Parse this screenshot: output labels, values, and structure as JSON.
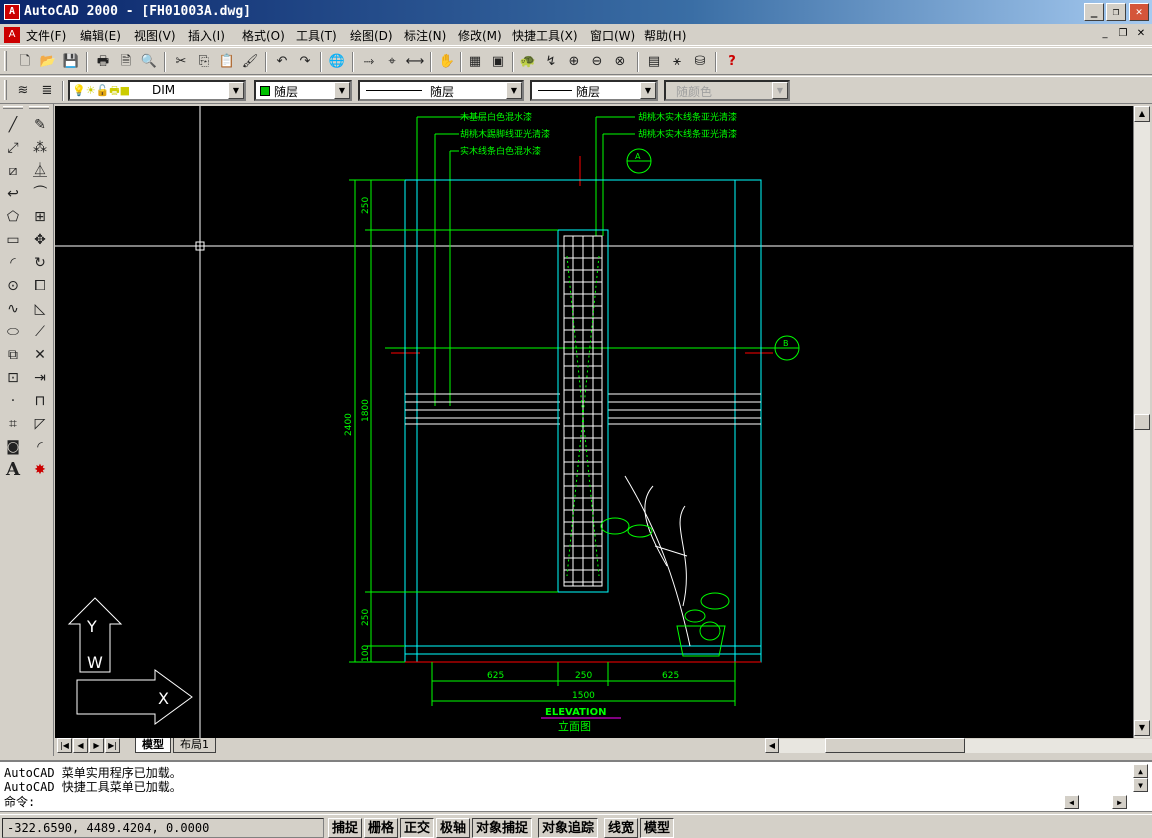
{
  "window": {
    "app_icon": "autocad-logo-icon",
    "title": "AutoCAD 2000 - [FH01003A.dwg]",
    "buttons": [
      "_",
      "❐",
      "✕"
    ]
  },
  "menu": {
    "items": [
      "文件(F)",
      "编辑(E)",
      "视图(V)",
      "插入(I)",
      "格式(O)",
      "工具(T)",
      "绘图(D)",
      "标注(N)",
      "修改(M)",
      "快捷工具(X)",
      "窗口(W)",
      "帮助(H)"
    ],
    "mdi_buttons": [
      "_",
      "❐",
      "✕"
    ]
  },
  "toolbar_standard": {
    "icons": [
      "new-icon",
      "open-icon",
      "save-icon",
      "print-icon",
      "print-preview-icon",
      "find-icon",
      "cut-icon",
      "copy-icon",
      "paste-icon",
      "match-properties-icon",
      "undo-icon",
      "redo-icon",
      "web-icon",
      "snap-from-icon",
      "tracking-icon",
      "distance-icon",
      "pan-icon",
      "zoom-realtime-icon",
      "zoom-window-icon",
      "zoom-previous-icon",
      "aerial-view-icon",
      "properties-icon",
      "design-center-icon",
      "database-icon",
      "help-icon"
    ]
  },
  "toolbar_properties": {
    "layer_value": "DIM",
    "color_value": "随层",
    "linetype_value": "随层",
    "lineweight_value": "随层",
    "plotstyle_value": "随颜色"
  },
  "left_tools": {
    "draw": [
      "line-icon",
      "construction-line-icon",
      "polyline-icon",
      "polygon-icon",
      "rectangle-icon",
      "arc-icon",
      "circle-icon",
      "spline-icon",
      "ellipse-icon",
      "insert-block-icon",
      "make-block-icon",
      "point-icon",
      "hatch-icon",
      "region-icon",
      "text-icon"
    ],
    "modify": [
      "erase-icon",
      "copy-object-icon",
      "mirror-icon",
      "offset-icon",
      "array-icon",
      "move-icon",
      "rotate-icon",
      "scale-icon",
      "stretch-icon",
      "lengthen-icon",
      "trim-icon",
      "extend-icon",
      "break-icon",
      "chamfer-icon",
      "fillet-icon",
      "explode-icon"
    ]
  },
  "drawing": {
    "annotations": [
      "木基层白色混水漆",
      "胡桃木踢脚线亚光清漆",
      "实木线条白色混水漆",
      "胡桃木实木线条亚光清漆",
      "胡桃木实木线条亚光清漆"
    ],
    "callout_a": "A",
    "callout_b": "B",
    "dims_vertical_outer": "2400",
    "dims_vertical_inner": [
      "250",
      "1800",
      "250",
      "100"
    ],
    "dims_horizontal": [
      "625",
      "250",
      "625"
    ],
    "dims_total": "1500",
    "title_en": "ELEVATION",
    "title_cn": "立面图",
    "ucs_y": "Y",
    "ucs_w": "W",
    "ucs_x": "X",
    "colors": {
      "cyan": "#00ffff",
      "green": "#00ff00",
      "red": "#ff0000",
      "white": "#ffffff",
      "magenta": "#ff00ff"
    }
  },
  "tabs": {
    "nav": [
      "|◀",
      "◀",
      "▶",
      "▶|"
    ],
    "items": [
      "模型",
      "布局1"
    ]
  },
  "command": {
    "lines": [
      "AutoCAD 菜单实用程序已加载。",
      "AutoCAD 快捷工具菜单已加载。"
    ],
    "prompt": "命令:"
  },
  "status": {
    "coords": "-322.6590,  4489.4204, 0.0000",
    "toggles": [
      "捕捉",
      "栅格",
      "正交",
      "极轴",
      "对象捕捉",
      "对象追踪",
      "线宽",
      "模型"
    ]
  }
}
